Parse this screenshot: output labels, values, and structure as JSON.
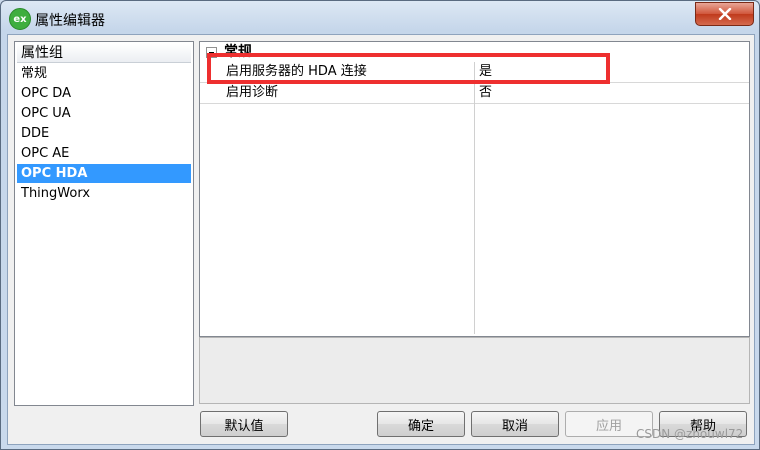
{
  "window": {
    "title": "属性编辑器",
    "app_icon_text": "ex"
  },
  "left_panel": {
    "header": "属性组",
    "items": [
      "常规",
      "OPC DA",
      "OPC UA",
      "DDE",
      "OPC AE",
      "OPC HDA",
      "ThingWorx"
    ],
    "selected": "OPC HDA"
  },
  "property_grid": {
    "section": "常规",
    "rows": [
      {
        "name": "启用服务器的 HDA 连接",
        "value": "是"
      },
      {
        "name": "启用诊断",
        "value": "否"
      }
    ]
  },
  "buttons": {
    "defaults": "默认值",
    "ok": "确定",
    "cancel": "取消",
    "apply": "应用",
    "help": "帮助"
  },
  "watermark": "CSDN @zhouwl72",
  "colors": {
    "selection": "#3399ff",
    "highlight_box": "#ee2f2f"
  }
}
